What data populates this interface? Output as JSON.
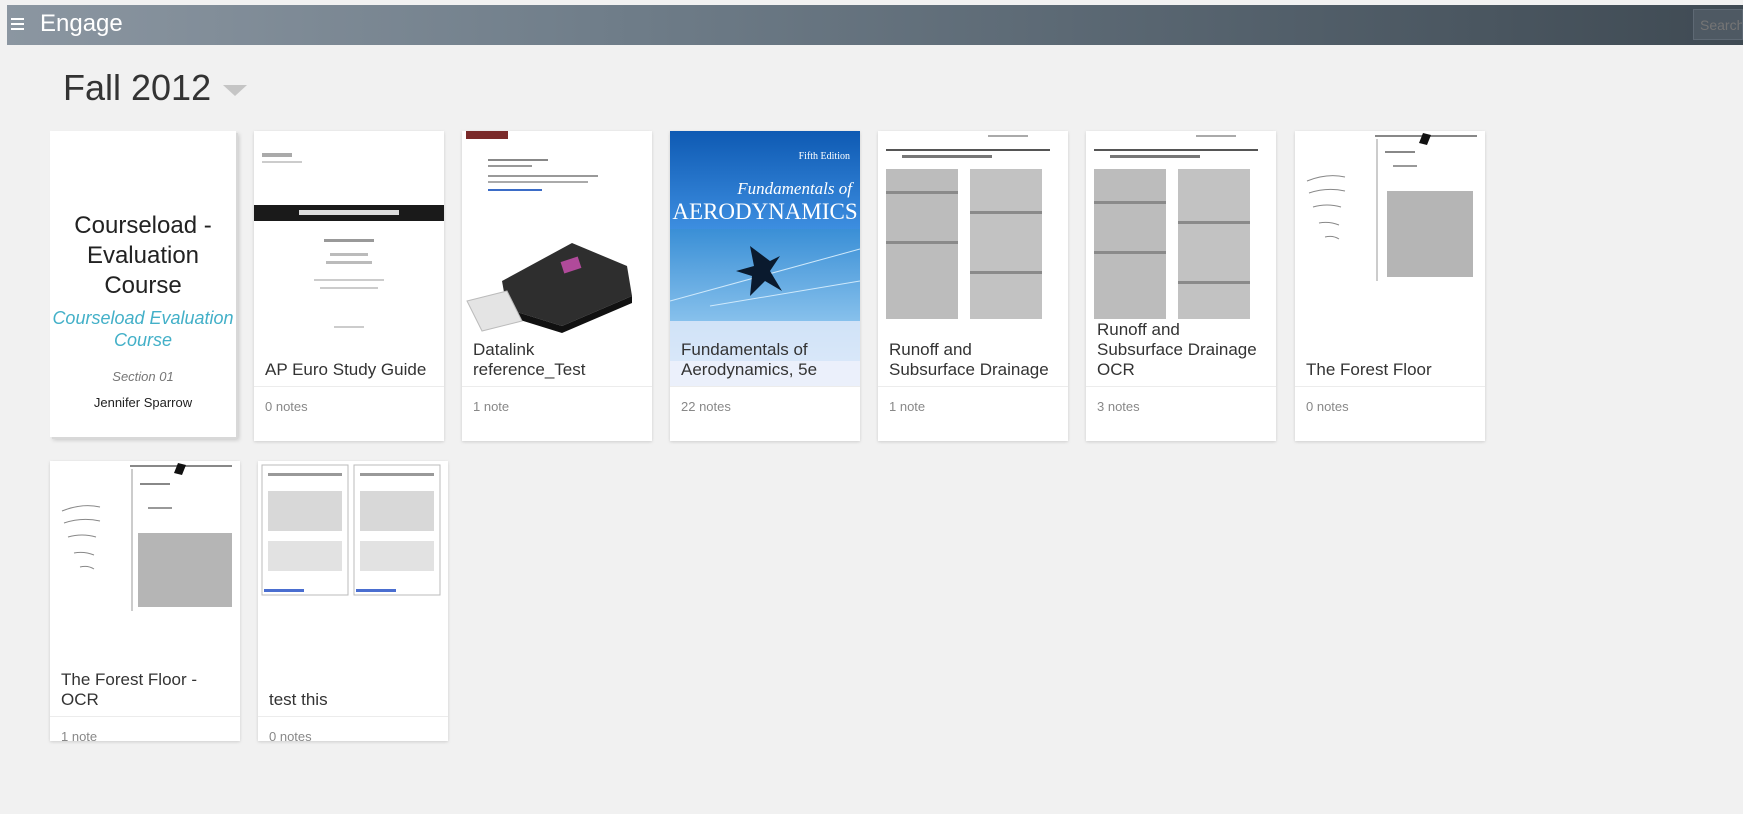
{
  "app": {
    "title": "Engage"
  },
  "search": {
    "placeholder": "Search"
  },
  "term": {
    "title": "Fall 2012"
  },
  "course": {
    "name": "Courseload - Evaluation Course",
    "subtitle": "Courseload Evaluation Course",
    "section": "Section 01",
    "instructor": "Jennifer Sparrow"
  },
  "books": [
    {
      "title": "AP Euro Study Guide",
      "notes": "0 notes"
    },
    {
      "title": "Datalink reference_Test",
      "notes": "1 note"
    },
    {
      "title": "Fundamentals of Aerodynamics, 5e",
      "notes": "22 notes",
      "cover_edition": "Fifth Edition",
      "cover_title_line1": "Fundamentals of",
      "cover_title_line2": "AERODYNAMICS"
    },
    {
      "title": "Runoff and Subsurface Drainage",
      "notes": "1 note"
    },
    {
      "title": "Runoff and Subsurface Drainage OCR",
      "notes": "3 notes"
    },
    {
      "title": "The Forest Floor",
      "notes": "0 notes"
    },
    {
      "title": "The Forest Floor - OCR",
      "notes": "1 note"
    },
    {
      "title": "test this",
      "notes": "0 notes"
    }
  ],
  "colors": {
    "accent": "#43b0c8",
    "topbar": "#55626d",
    "aero_blue": "#1d6fc0"
  }
}
